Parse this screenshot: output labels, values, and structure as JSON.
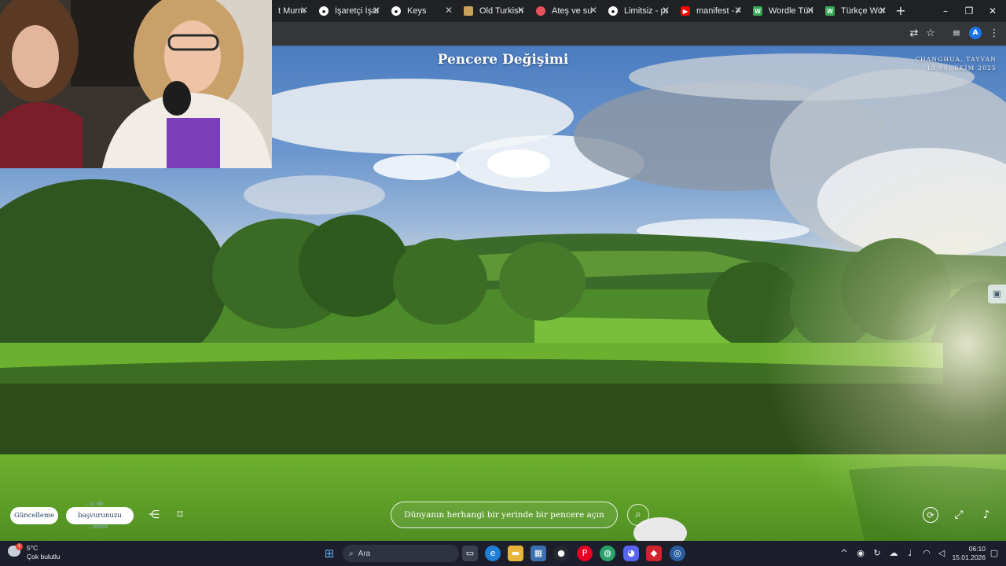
{
  "browser": {
    "tabs": [
      {
        "title": "t Murm",
        "icon": "tab-icon-generic",
        "color": "#444"
      },
      {
        "title": "İşaretçi İşare",
        "icon": "github-icon",
        "color": "#ffffff"
      },
      {
        "title": "Keys",
        "icon": "github-icon",
        "color": "#ffffff"
      },
      {
        "title": "Old Turkish",
        "icon": "flag-icon",
        "color": "#c8a15a"
      },
      {
        "title": "Ateş ve su",
        "icon": "ring-icon",
        "color": "#e8525c"
      },
      {
        "title": "Limitsiz - pa",
        "icon": "circle-icon",
        "color": "#ffffff"
      },
      {
        "title": "manifest - A",
        "icon": "youtube-icon",
        "color": "#ff0000"
      },
      {
        "title": "Wordle Türk",
        "icon": "wordle-icon",
        "color": "#3aa757"
      },
      {
        "title": "Türkçe Word",
        "icon": "wordle-icon",
        "color": "#3aa757"
      }
    ],
    "new_tab_label": "+",
    "window_controls": [
      "–",
      "❐",
      "✕"
    ],
    "profile_initial": "A"
  },
  "scene": {
    "title": "Pencere Değişimi",
    "location": "CHANGHUA, TAYVAN",
    "time": "13:00, EKİM 2025"
  },
  "controls": {
    "update_label": "Güncelleme",
    "submit_label": "başvurunuzu",
    "submit_overlay_top": "...iz de",
    "submit_overlay_bottom": "...derin",
    "search_placeholder": "Dünyanın herhangi bir yerinde bir pencere açın"
  },
  "taskbar": {
    "search_label": "Ara",
    "weather_temp": "5°C",
    "weather_desc": "Çok bulutlu",
    "weather_badge": "1",
    "time": "06:10",
    "date": "15.01.2026"
  },
  "colors": {
    "accent_blue": "#1a73e8",
    "taskbar_bg": "#1c1f2b",
    "tab_bg": "#202124",
    "toolbar_bg": "#35363a"
  }
}
